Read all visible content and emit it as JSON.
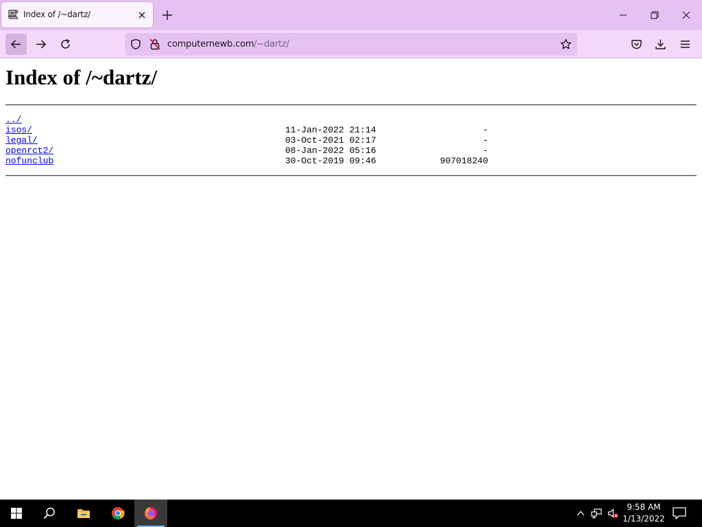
{
  "browser": {
    "tab": {
      "title": "Index of /~dartz/",
      "favicon": "server-icon"
    },
    "url": {
      "host": "computernewb.com",
      "path": "/~dartz/"
    },
    "colors": {
      "tabstrip": "#e6c2f2",
      "toolbar": "#f3d8fa",
      "urlbar": "#e6c2f2"
    }
  },
  "page": {
    "title": "Index of /~dartz/",
    "link_color": "#0000ee",
    "entries": [
      {
        "name": "../",
        "date": "",
        "size": ""
      },
      {
        "name": "isos/",
        "date": "11-Jan-2022 21:14",
        "size": "-"
      },
      {
        "name": "legal/",
        "date": "03-Oct-2021 02:17",
        "size": "-"
      },
      {
        "name": "openrct2/",
        "date": "08-Jan-2022 05:16",
        "size": "-"
      },
      {
        "name": "nofunclub",
        "date": "30-Oct-2019 09:46",
        "size": "907018240"
      }
    ]
  },
  "taskbar": {
    "apps": [
      "start-icon",
      "search-icon",
      "file-explorer-icon",
      "chrome-icon",
      "firefox-icon"
    ],
    "active_app": "firefox-icon",
    "clock": {
      "time": "9:58 AM",
      "date": "1/13/2022"
    }
  }
}
